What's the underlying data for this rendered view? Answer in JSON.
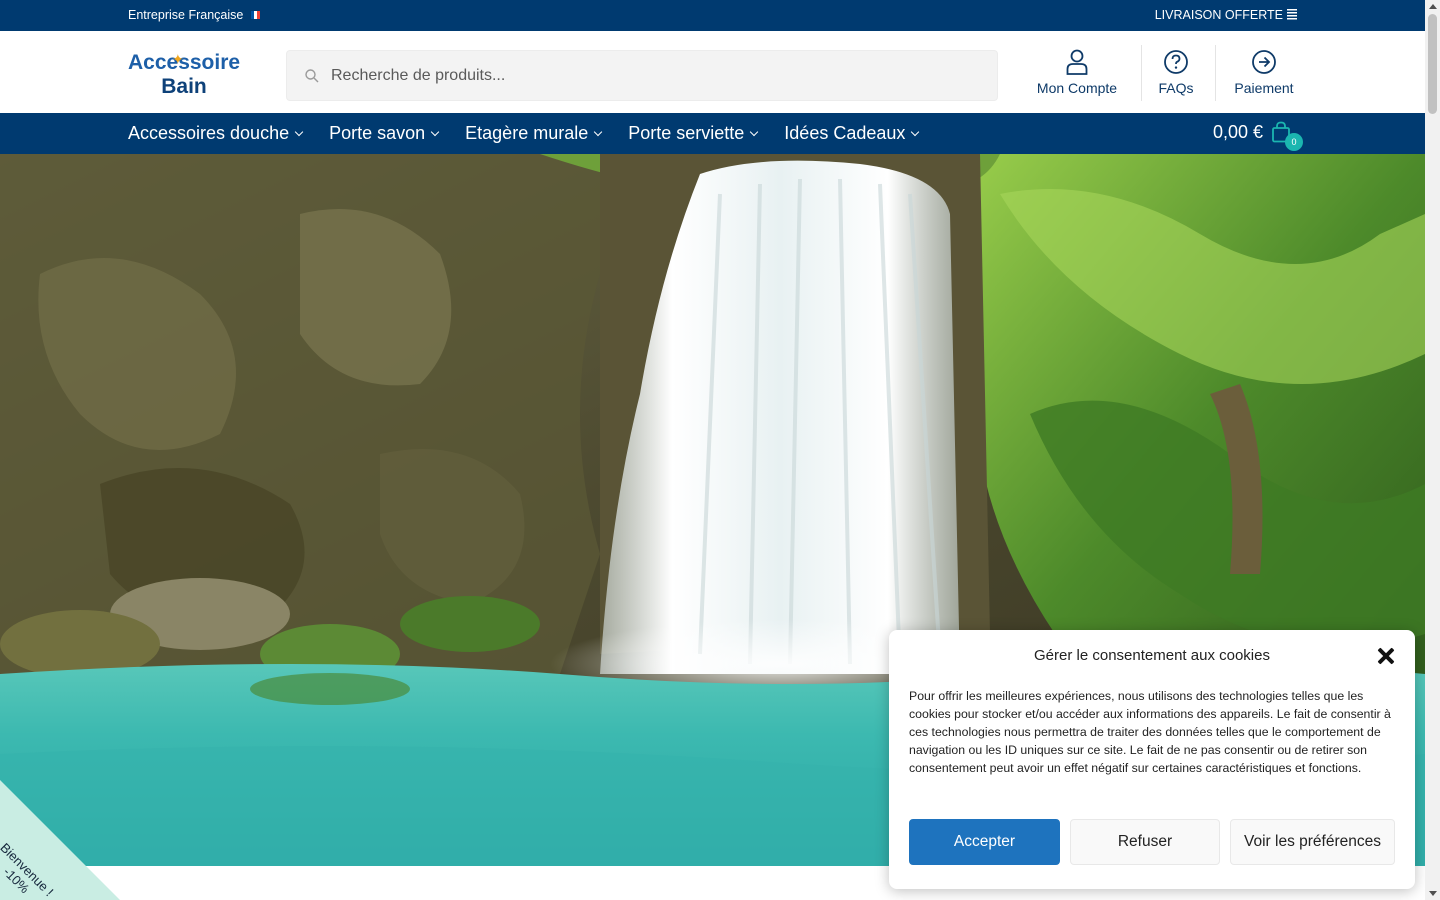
{
  "topbar": {
    "left_text": "Entreprise Française",
    "right_text": "LIVRAISON OFFERTE",
    "flag_colors": [
      "#0055a4",
      "#ffffff",
      "#ef4135"
    ]
  },
  "header": {
    "logo": {
      "line1": "Accessoire",
      "line2": "Bain"
    },
    "search": {
      "placeholder": "Recherche de produits..."
    },
    "icons": [
      {
        "label": "Mon Compte",
        "icon": "user-icon"
      },
      {
        "label": "FAQs",
        "icon": "question-circle-icon"
      },
      {
        "label": "Paiement",
        "icon": "arrow-circle-right-icon"
      }
    ]
  },
  "nav": {
    "items": [
      {
        "label": "Accessoires douche"
      },
      {
        "label": "Porte savon"
      },
      {
        "label": "Etagère murale"
      },
      {
        "label": "Porte serviette"
      },
      {
        "label": "Idées Cadeaux"
      }
    ],
    "cart": {
      "total": "0,00 €",
      "count": "0"
    }
  },
  "hero": {
    "image": "waterfall-landscape"
  },
  "ribbon": {
    "line1": "Bienvenue !",
    "line2": "-10%"
  },
  "cookie": {
    "title": "Gérer le consentement aux cookies",
    "body": "Pour offrir les meilleures expériences, nous utilisons des technologies telles que les cookies pour stocker et/ou accéder aux informations des appareils. Le fait de consentir à ces technologies nous permettra de traiter des données telles que le comportement de navigation ou les ID uniques sur ce site. Le fait de ne pas consentir ou de retirer son consentement peut avoir un effet négatif sur certaines caractéristiques et fonctions.",
    "accept_label": "Accepter",
    "refuse_label": "Refuser",
    "prefs_label": "Voir les préférences"
  },
  "colors": {
    "brand_navy": "#003a70",
    "accept_blue": "#1e73be",
    "cart_badge": "#1bb6b0"
  }
}
